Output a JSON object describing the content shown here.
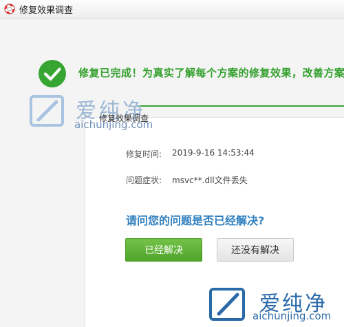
{
  "window": {
    "title": "修复效果调查",
    "icon": "lifebuoy-icon"
  },
  "banner": {
    "icon": "success-check-icon",
    "headline": "修复已完成！为真实了解每个方案的修复效果，改善方案",
    "accent_color": "#33a02c"
  },
  "watermark_top": {
    "brand": "爱纯净",
    "url": "aichunjing.com"
  },
  "dialog": {
    "title": "修复效果调查",
    "repair_time_label": "修复时间:",
    "repair_time_value": "2019-9-16 14:53:44",
    "symptom_label": "问题症状:",
    "symptom_value": "msvc**.dll文件丢失",
    "question": "请问您的问题是否已经解决?",
    "question_color": "#2f7fbf",
    "resolved_button": "已经解决",
    "unresolved_button": "还没有解决"
  },
  "watermark_bottom": {
    "brand": "爱纯净",
    "url": "aichunjing.com"
  }
}
